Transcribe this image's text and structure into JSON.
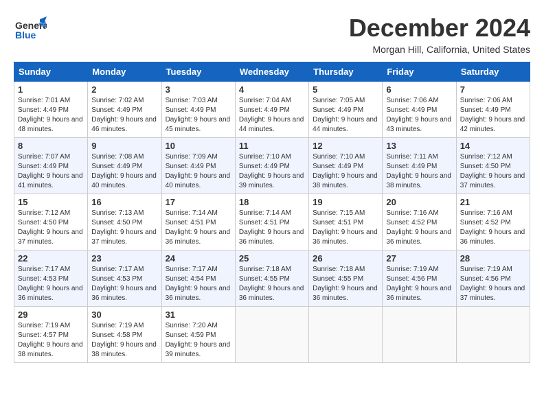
{
  "header": {
    "logo_line1": "General",
    "logo_line2": "Blue",
    "month": "December 2024",
    "location": "Morgan Hill, California, United States"
  },
  "weekdays": [
    "Sunday",
    "Monday",
    "Tuesday",
    "Wednesday",
    "Thursday",
    "Friday",
    "Saturday"
  ],
  "weeks": [
    [
      {
        "day": "1",
        "sunrise": "Sunrise: 7:01 AM",
        "sunset": "Sunset: 4:49 PM",
        "daylight": "Daylight: 9 hours and 48 minutes."
      },
      {
        "day": "2",
        "sunrise": "Sunrise: 7:02 AM",
        "sunset": "Sunset: 4:49 PM",
        "daylight": "Daylight: 9 hours and 46 minutes."
      },
      {
        "day": "3",
        "sunrise": "Sunrise: 7:03 AM",
        "sunset": "Sunset: 4:49 PM",
        "daylight": "Daylight: 9 hours and 45 minutes."
      },
      {
        "day": "4",
        "sunrise": "Sunrise: 7:04 AM",
        "sunset": "Sunset: 4:49 PM",
        "daylight": "Daylight: 9 hours and 44 minutes."
      },
      {
        "day": "5",
        "sunrise": "Sunrise: 7:05 AM",
        "sunset": "Sunset: 4:49 PM",
        "daylight": "Daylight: 9 hours and 44 minutes."
      },
      {
        "day": "6",
        "sunrise": "Sunrise: 7:06 AM",
        "sunset": "Sunset: 4:49 PM",
        "daylight": "Daylight: 9 hours and 43 minutes."
      },
      {
        "day": "7",
        "sunrise": "Sunrise: 7:06 AM",
        "sunset": "Sunset: 4:49 PM",
        "daylight": "Daylight: 9 hours and 42 minutes."
      }
    ],
    [
      {
        "day": "8",
        "sunrise": "Sunrise: 7:07 AM",
        "sunset": "Sunset: 4:49 PM",
        "daylight": "Daylight: 9 hours and 41 minutes."
      },
      {
        "day": "9",
        "sunrise": "Sunrise: 7:08 AM",
        "sunset": "Sunset: 4:49 PM",
        "daylight": "Daylight: 9 hours and 40 minutes."
      },
      {
        "day": "10",
        "sunrise": "Sunrise: 7:09 AM",
        "sunset": "Sunset: 4:49 PM",
        "daylight": "Daylight: 9 hours and 40 minutes."
      },
      {
        "day": "11",
        "sunrise": "Sunrise: 7:10 AM",
        "sunset": "Sunset: 4:49 PM",
        "daylight": "Daylight: 9 hours and 39 minutes."
      },
      {
        "day": "12",
        "sunrise": "Sunrise: 7:10 AM",
        "sunset": "Sunset: 4:49 PM",
        "daylight": "Daylight: 9 hours and 38 minutes."
      },
      {
        "day": "13",
        "sunrise": "Sunrise: 7:11 AM",
        "sunset": "Sunset: 4:49 PM",
        "daylight": "Daylight: 9 hours and 38 minutes."
      },
      {
        "day": "14",
        "sunrise": "Sunrise: 7:12 AM",
        "sunset": "Sunset: 4:50 PM",
        "daylight": "Daylight: 9 hours and 37 minutes."
      }
    ],
    [
      {
        "day": "15",
        "sunrise": "Sunrise: 7:12 AM",
        "sunset": "Sunset: 4:50 PM",
        "daylight": "Daylight: 9 hours and 37 minutes."
      },
      {
        "day": "16",
        "sunrise": "Sunrise: 7:13 AM",
        "sunset": "Sunset: 4:50 PM",
        "daylight": "Daylight: 9 hours and 37 minutes."
      },
      {
        "day": "17",
        "sunrise": "Sunrise: 7:14 AM",
        "sunset": "Sunset: 4:51 PM",
        "daylight": "Daylight: 9 hours and 36 minutes."
      },
      {
        "day": "18",
        "sunrise": "Sunrise: 7:14 AM",
        "sunset": "Sunset: 4:51 PM",
        "daylight": "Daylight: 9 hours and 36 minutes."
      },
      {
        "day": "19",
        "sunrise": "Sunrise: 7:15 AM",
        "sunset": "Sunset: 4:51 PM",
        "daylight": "Daylight: 9 hours and 36 minutes."
      },
      {
        "day": "20",
        "sunrise": "Sunrise: 7:16 AM",
        "sunset": "Sunset: 4:52 PM",
        "daylight": "Daylight: 9 hours and 36 minutes."
      },
      {
        "day": "21",
        "sunrise": "Sunrise: 7:16 AM",
        "sunset": "Sunset: 4:52 PM",
        "daylight": "Daylight: 9 hours and 36 minutes."
      }
    ],
    [
      {
        "day": "22",
        "sunrise": "Sunrise: 7:17 AM",
        "sunset": "Sunset: 4:53 PM",
        "daylight": "Daylight: 9 hours and 36 minutes."
      },
      {
        "day": "23",
        "sunrise": "Sunrise: 7:17 AM",
        "sunset": "Sunset: 4:53 PM",
        "daylight": "Daylight: 9 hours and 36 minutes."
      },
      {
        "day": "24",
        "sunrise": "Sunrise: 7:17 AM",
        "sunset": "Sunset: 4:54 PM",
        "daylight": "Daylight: 9 hours and 36 minutes."
      },
      {
        "day": "25",
        "sunrise": "Sunrise: 7:18 AM",
        "sunset": "Sunset: 4:55 PM",
        "daylight": "Daylight: 9 hours and 36 minutes."
      },
      {
        "day": "26",
        "sunrise": "Sunrise: 7:18 AM",
        "sunset": "Sunset: 4:55 PM",
        "daylight": "Daylight: 9 hours and 36 minutes."
      },
      {
        "day": "27",
        "sunrise": "Sunrise: 7:19 AM",
        "sunset": "Sunset: 4:56 PM",
        "daylight": "Daylight: 9 hours and 36 minutes."
      },
      {
        "day": "28",
        "sunrise": "Sunrise: 7:19 AM",
        "sunset": "Sunset: 4:56 PM",
        "daylight": "Daylight: 9 hours and 37 minutes."
      }
    ],
    [
      {
        "day": "29",
        "sunrise": "Sunrise: 7:19 AM",
        "sunset": "Sunset: 4:57 PM",
        "daylight": "Daylight: 9 hours and 38 minutes."
      },
      {
        "day": "30",
        "sunrise": "Sunrise: 7:19 AM",
        "sunset": "Sunset: 4:58 PM",
        "daylight": "Daylight: 9 hours and 38 minutes."
      },
      {
        "day": "31",
        "sunrise": "Sunrise: 7:20 AM",
        "sunset": "Sunset: 4:59 PM",
        "daylight": "Daylight: 9 hours and 39 minutes."
      },
      null,
      null,
      null,
      null
    ]
  ]
}
